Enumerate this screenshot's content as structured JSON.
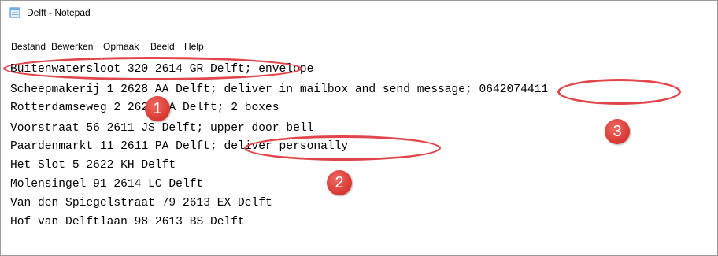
{
  "window": {
    "title": "Delft - Notepad"
  },
  "menu": [
    {
      "label": "Bestand"
    },
    {
      "label": "Bewerken"
    },
    {
      "label": "Opmaak"
    },
    {
      "label": "Beeld"
    },
    {
      "label": "Help"
    }
  ],
  "document_lines": [
    "Buitenwatersloot 320 2614 GR Delft; envelope",
    "Scheepmakerij 1 2628 AA Delft; deliver in mailbox and send message; 0642074411",
    "Rotterdamseweg 2 2628 AA Delft; 2 boxes",
    "Voorstraat 56 2611 JS Delft; upper door bell",
    "Paardenmarkt 11 2611 PA Delft; deliver personally",
    "Het Slot 5 2622 KH Delft",
    "Molensingel 91 2614 LC Delft",
    "Van den Spiegelstraat 79 2613 EX Delft",
    "Hof van Delftlaan 98 2613 BS Delft"
  ],
  "annotations": [
    {
      "number": "1"
    },
    {
      "number": "2"
    },
    {
      "number": "3"
    }
  ],
  "colors": {
    "annotation_red": "#e0464b"
  }
}
